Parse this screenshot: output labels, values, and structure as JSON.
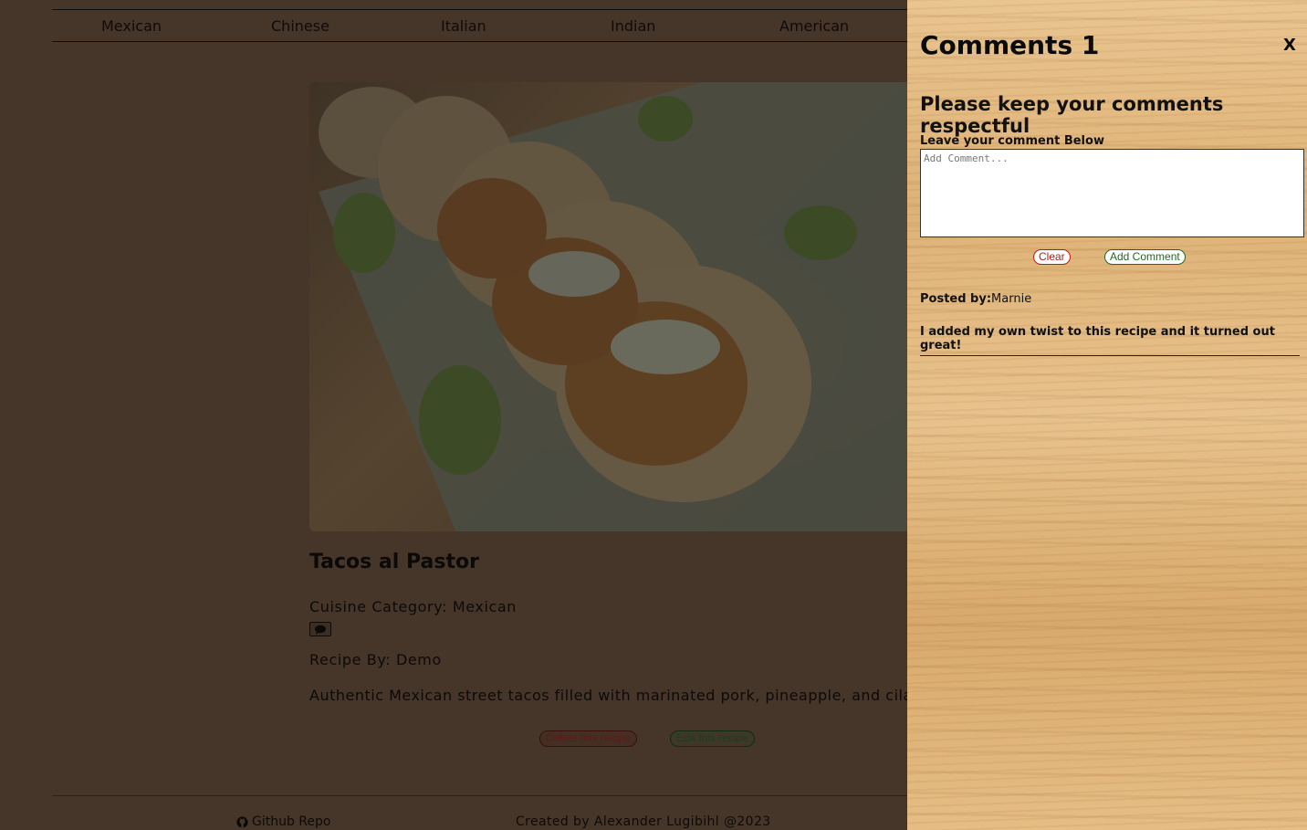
{
  "nav": {
    "items": [
      {
        "label": "Mexican"
      },
      {
        "label": "Chinese"
      },
      {
        "label": "Italian"
      },
      {
        "label": "Indian"
      },
      {
        "label": "American"
      }
    ]
  },
  "recipe": {
    "title": "Tacos al Pastor",
    "cuisine_label": "Cuisine Category:",
    "cuisine": "Mexican",
    "author_label": "Recipe By:",
    "author": "Demo",
    "description": "Authentic Mexican street tacos filled with marinated pork, pineapple, and cilantro.",
    "comment_icon": "speech-bubble-icon",
    "delete_label": "Delete this recipe",
    "edit_label": "Edit this recipe"
  },
  "footer": {
    "repo_label": "Github Repo",
    "repo_icon": "github-icon",
    "credit": "Created by Alexander Lugibihl @2023"
  },
  "comments_panel": {
    "title": "Comments 1",
    "close_label": "X",
    "subtitle": "Please keep your comments respectful",
    "field_label": "Leave your comment Below",
    "placeholder": "Add Comment...",
    "clear_label": "Clear",
    "add_label": "Add Comment",
    "comments": [
      {
        "posted_by_label": "Posted by:",
        "author": "Marnie",
        "text": "I added my own twist to this recipe and it turned out great!"
      }
    ]
  },
  "colors": {
    "clear_button": "#c01a10",
    "add_button": "#206a21",
    "overlay_dim": "#463629"
  }
}
